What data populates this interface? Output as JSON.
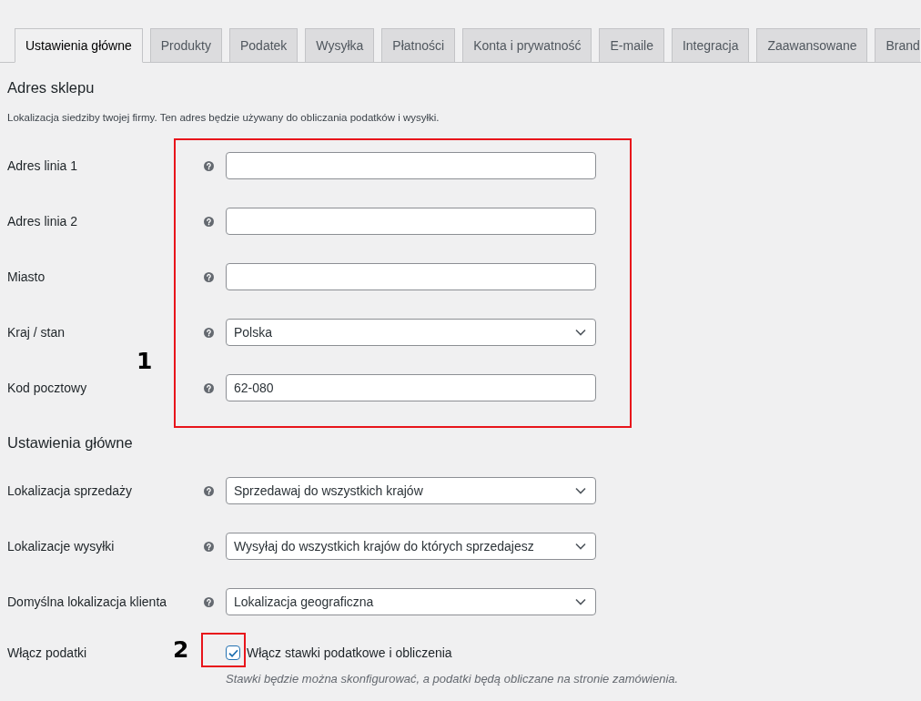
{
  "tabs": [
    {
      "label": "Ustawienia główne",
      "selected": true
    },
    {
      "label": "Produkty",
      "selected": false
    },
    {
      "label": "Podatek",
      "selected": false
    },
    {
      "label": "Wysyłka",
      "selected": false
    },
    {
      "label": "Płatności",
      "selected": false
    },
    {
      "label": "Konta i prywatność",
      "selected": false
    },
    {
      "label": "E-maile",
      "selected": false
    },
    {
      "label": "Integracja",
      "selected": false
    },
    {
      "label": "Zaawansowane",
      "selected": false
    },
    {
      "label": "Brand",
      "selected": false
    }
  ],
  "sections": [
    {
      "title": "Adres sklepu",
      "description": "Lokalizacja siedziby twojej firmy. Ten adres będzie używany do obliczania podatków i wysyłki.",
      "fields": [
        {
          "kind": "text",
          "label": "Adres linia 1"
        },
        {
          "kind": "text",
          "label": "Adres linia 2"
        },
        {
          "kind": "text",
          "label": "Miasto"
        },
        {
          "kind": "select",
          "label": "Kraj / stan",
          "value": "Polska"
        },
        {
          "kind": "text",
          "label": "Kod pocztowy",
          "value": "62-080"
        }
      ]
    },
    {
      "title": "Ustawienia główne",
      "fields": [
        {
          "kind": "select",
          "label": "Lokalizacja sprzedaży",
          "value": "Sprzedawaj do wszystkich krajów"
        },
        {
          "kind": "select",
          "label": "Lokalizacje wysyłki",
          "value": "Wysyłaj do wszystkich krajów do których sprzedajesz"
        },
        {
          "kind": "select",
          "label": "Domyślna lokalizacja klienta",
          "value": "Lokalizacja geograficzna"
        },
        {
          "kind": "checkbox",
          "label": "Włącz podatki",
          "option": "Włącz stawki podatkowe i obliczenia",
          "checked": true,
          "description": "Stawki będzie można skonfigurować, a podatki będą obliczane na stronie zamówienia."
        }
      ]
    }
  ],
  "annotations": [
    {
      "label": "1"
    },
    {
      "label": "2"
    }
  ]
}
